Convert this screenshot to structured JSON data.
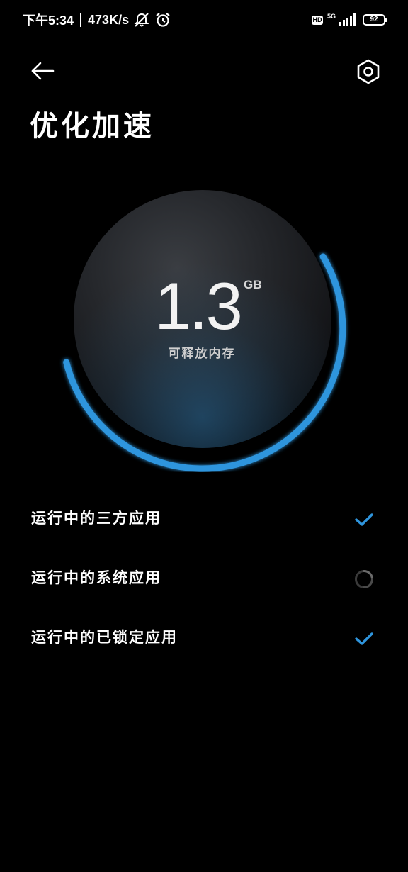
{
  "status_bar": {
    "time": "下午5:34",
    "network_speed": "473K/s",
    "hd_badge": "HD",
    "network_type": "5G",
    "battery_level": "92",
    "icons": [
      "notifications-muted-icon",
      "alarm-icon",
      "hd-icon",
      "signal-icon",
      "battery-icon"
    ]
  },
  "header": {
    "back_icon": "arrow-left-icon",
    "settings_icon": "hexagon-settings-icon",
    "title": "优化加速"
  },
  "memory": {
    "value": "1.3",
    "unit": "GB",
    "label": "可释放内存",
    "ring_color": "#2f95dd"
  },
  "tasks": [
    {
      "label": "运行中的三方应用",
      "status": "done",
      "status_icon": "checkmark-icon"
    },
    {
      "label": "运行中的系统应用",
      "status": "loading",
      "status_icon": "loading-spinner-icon"
    },
    {
      "label": "运行中的已锁定应用",
      "status": "done",
      "status_icon": "checkmark-icon"
    }
  ],
  "colors": {
    "background": "#000000",
    "accent": "#2f95dd",
    "text": "#ffffff"
  }
}
